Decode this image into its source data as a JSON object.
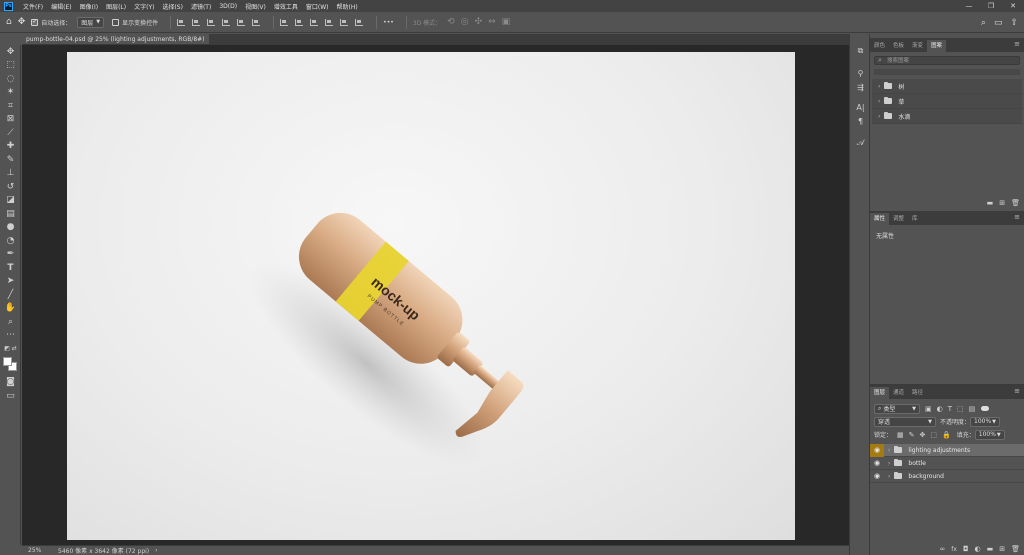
{
  "app": {
    "logo": "Ps"
  },
  "menu": [
    "文件(F)",
    "编辑(E)",
    "图像(I)",
    "图层(L)",
    "文字(Y)",
    "选择(S)",
    "滤镜(T)",
    "3D(D)",
    "视图(V)",
    "增效工具",
    "窗口(W)",
    "帮助(H)"
  ],
  "window_controls": {
    "minimize": "—",
    "restore": "❐",
    "close": "✕"
  },
  "options": {
    "auto_select_label": "自动选择：",
    "auto_select_value": "图层",
    "transform_label": "显示变换控件",
    "mode_3d_label": "3D 模式：",
    "more": "•••"
  },
  "document": {
    "tab_title": "pump-bottle-04.psd @ 25% (lighting adjustments, RGB/8#)",
    "tab_close": "×",
    "zoom": "25%",
    "status": "5460 像素 x 3642 像素 (72 ppi)",
    "status_arrow": "›"
  },
  "mockup": {
    "label_line1": "mock-up",
    "label_line2": "PUMP BOTTLE"
  },
  "libraries_panel": {
    "tabs": [
      "颜色",
      "色板",
      "渐变",
      "图案"
    ],
    "active_tab": 3,
    "search_placeholder": "搜索图案",
    "items": [
      {
        "label": "树"
      },
      {
        "label": "草"
      },
      {
        "label": "水滴"
      }
    ]
  },
  "properties_panel": {
    "tabs": [
      "属性",
      "调整",
      "库"
    ],
    "active_tab": 0,
    "empty_text": "无属性"
  },
  "layers_panel": {
    "tabs": [
      "图层",
      "通道",
      "路径"
    ],
    "active_tab": 0,
    "filter_kind": "类型",
    "blend_mode": "穿透",
    "opacity_label": "不透明度：",
    "opacity_value": "100%",
    "lock_label": "锁定：",
    "fill_label": "填充：",
    "fill_value": "100%",
    "layers": [
      {
        "name": "lighting adjustments",
        "active": true
      },
      {
        "name": "bottle",
        "active": false
      },
      {
        "name": "background",
        "active": false
      }
    ],
    "footer_fx": "fx"
  },
  "colors": {
    "active_layer_eye": "#a47a12",
    "bottle": "#d7aa83",
    "label_band": "#e8d431"
  }
}
